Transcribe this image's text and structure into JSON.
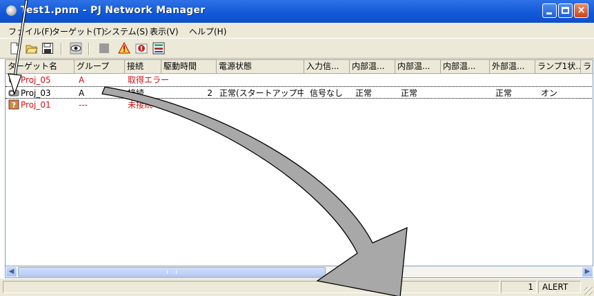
{
  "window": {
    "title": "Test1.pnm - PJ Network Manager",
    "buttons": {
      "minimize": "minimize",
      "maximize": "maximize",
      "close": "×"
    }
  },
  "menu": [
    {
      "label": "ファイル(F)"
    },
    {
      "label": "ターゲット(T)"
    },
    {
      "label": "システム(S)"
    },
    {
      "label": "表示(V)"
    },
    {
      "label": "ヘルプ(H)"
    }
  ],
  "toolbar": {
    "icons": [
      "new-file-icon",
      "open-folder-icon",
      "save-icon",
      "monitor-eye-icon",
      "stop-icon",
      "alert-icon",
      "info-icon",
      "grid-view-icon"
    ]
  },
  "list": {
    "columns": [
      {
        "label": "ターゲット名"
      },
      {
        "label": "グループ"
      },
      {
        "label": "接続"
      },
      {
        "label": "駆動時間"
      },
      {
        "label": "電源状態"
      },
      {
        "label": "入力信..."
      },
      {
        "label": "内部温..."
      },
      {
        "label": "内部温..."
      },
      {
        "label": "内部温..."
      },
      {
        "label": "外部温..."
      },
      {
        "label": "ランプ1状..."
      },
      {
        "label": "ラン"
      }
    ],
    "rows": [
      {
        "name": "Proj_05",
        "group": "A",
        "connection": "取得エラー",
        "hours": "",
        "power": "",
        "input": "",
        "temp1": "",
        "temp2": "",
        "temp3": "",
        "ext": "",
        "lamp": "",
        "status": "error",
        "icon": "projector-error-icon"
      },
      {
        "name": "Proj_03",
        "group": "A",
        "connection": "接続",
        "hours": "2",
        "power": "正常(スタートアップ中)",
        "input": "信号なし",
        "temp1": "正常",
        "temp2": "正常",
        "temp3": "",
        "ext": "正常",
        "lamp": "オン",
        "status": "ok",
        "icon": "projector-icon"
      },
      {
        "name": "Proj_01",
        "group": "---",
        "connection": "未接続",
        "hours": "",
        "power": "",
        "input": "",
        "temp1": "",
        "temp2": "",
        "temp3": "",
        "ext": "",
        "lamp": "",
        "status": "error",
        "icon": "projector-unknown-icon"
      }
    ]
  },
  "statusbar": {
    "count": "1",
    "alert": "ALERT"
  },
  "colors": {
    "title_blue": "#1158d8",
    "error_red": "#d01010",
    "arrow_gray": "#a8a8a8"
  }
}
